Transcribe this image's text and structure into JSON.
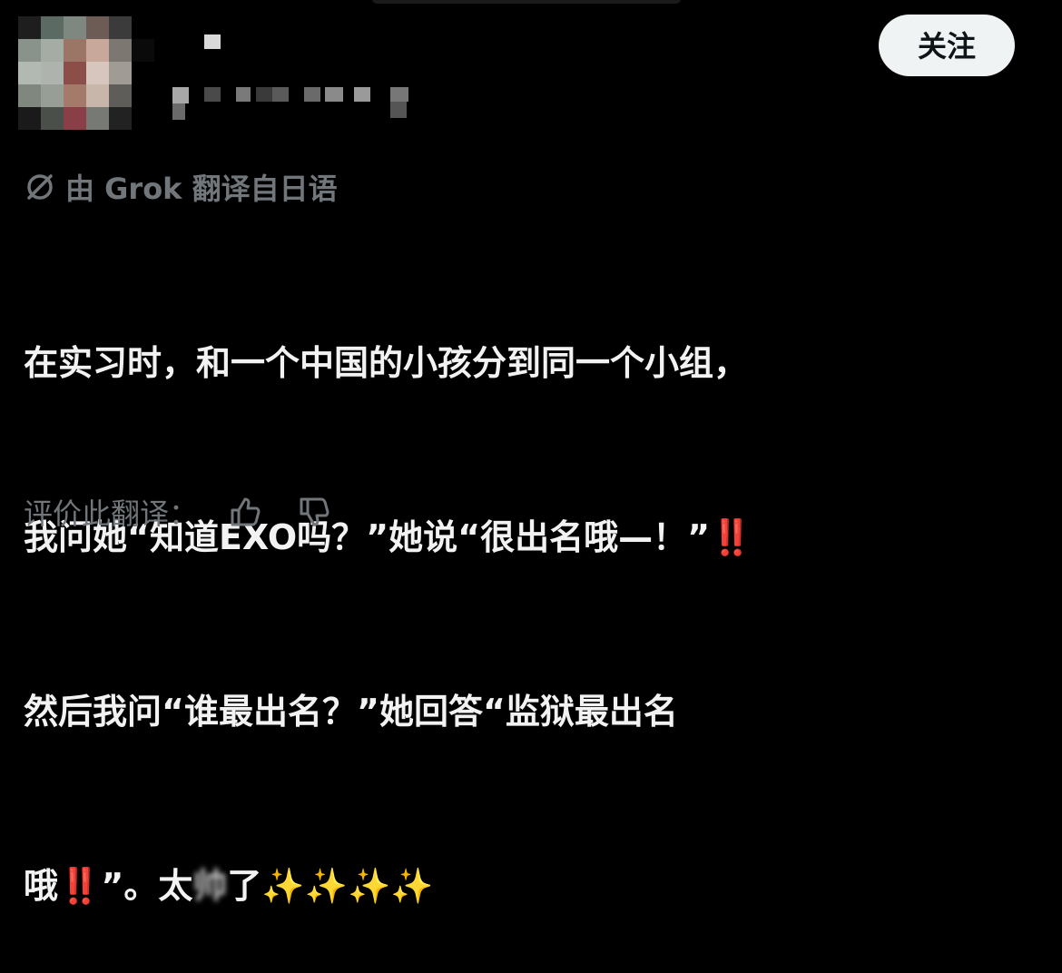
{
  "header": {
    "follow_label": "关注"
  },
  "translation": {
    "badge_icon": "translate-off-icon",
    "badge_text": "由 Grok 翻译自日语"
  },
  "post": {
    "line1": "在实习时，和一个中国的小孩分到同一个小组，",
    "line2_a": "我问她“知道EXO吗？”她说“很出名哦—！”",
    "line2_emoji": "‼️",
    "line3": "然后我问“谁最出名？”她回答“监狱最出名",
    "line4_a": "哦",
    "line4_emoji": "‼️",
    "line4_b": "”。太",
    "line4_blur": "帅",
    "line4_c": "了",
    "line4_sparkles": "✨✨✨✨"
  },
  "rating": {
    "label": "评价此翻译：",
    "thumbs_up_icon": "thumbs-up-icon",
    "thumbs_down_icon": "thumbs-down-icon"
  },
  "colors": {
    "background": "#000000",
    "text": "#f2f2f2",
    "muted": "#71767b",
    "follow_bg": "#eff3f4",
    "red_emoji": "#e5261f",
    "sparkle": "#ffd54a"
  }
}
